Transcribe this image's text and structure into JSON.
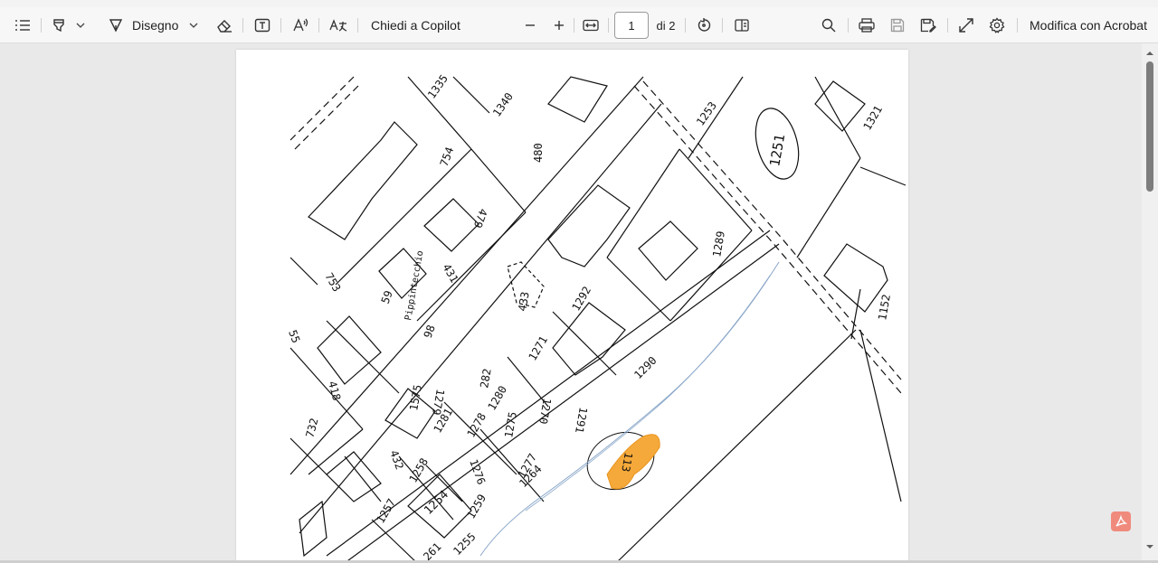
{
  "toolbar": {
    "draw_label": "Disegno",
    "copilot_label": "Chiedi a Copilot",
    "page_current": "1",
    "page_total_label": "di 2",
    "edit_acrobat_label": "Modifica con Acrobat"
  },
  "icons": {
    "contents": "list-icon",
    "highlight": "highlighter-icon",
    "draw": "pen-icon",
    "erase": "eraser-icon",
    "textbox": "text-box-icon",
    "read_aloud": "read-aloud-icon",
    "translate": "translate-icon",
    "zoom_out": "minus-icon",
    "zoom_in": "plus-icon",
    "fit": "fit-page-icon",
    "rotate": "rotate-icon",
    "page_view": "page-view-icon",
    "search": "search-icon",
    "print": "print-icon",
    "save": "save-icon",
    "save_as": "save-as-icon",
    "fullscreen": "expand-icon",
    "settings": "gear-icon",
    "acrobat": "acrobat-icon"
  },
  "colors": {
    "highlight": "#f5a93a",
    "toolbar_bg": "#f7f7f7",
    "viewer_bg": "#e9e9e9",
    "acrobat_badge": "#f08a7d"
  },
  "map": {
    "parcels": [
      "1335",
      "1340",
      "480",
      "754",
      "479",
      "1253",
      "1321",
      "1251",
      "753",
      "59",
      "Pippintecchio",
      "431",
      "433",
      "1289",
      "98",
      "1292",
      "55",
      "418",
      "282",
      "1271",
      "1575",
      "1279",
      "1280",
      "1270",
      "1291",
      "1290",
      "732",
      "1278",
      "1275",
      "1281",
      "432",
      "1276",
      "1277",
      "1258",
      "1264",
      "113",
      "1257",
      "1254",
      "1259",
      "1152",
      "1255",
      "261"
    ]
  }
}
